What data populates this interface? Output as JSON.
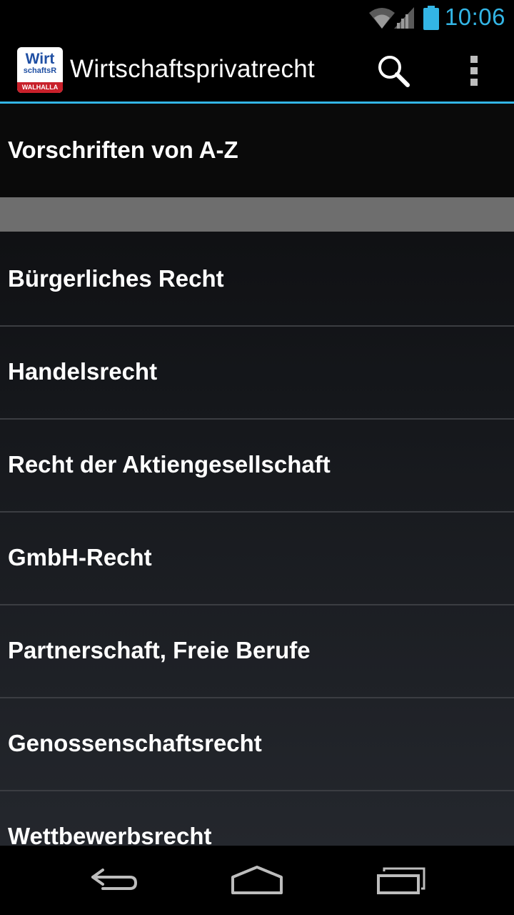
{
  "status_bar": {
    "time": "10:06",
    "icons": [
      "wifi-icon",
      "signal-icon",
      "battery-icon"
    ]
  },
  "action_bar": {
    "logo": {
      "line1": "Wirt",
      "line2": "schaftsR",
      "band": "WALHALLA"
    },
    "title": "Wirtschaftsprivatrecht",
    "icons": [
      "search-icon",
      "overflow-menu-icon"
    ]
  },
  "list": {
    "top_item": "Vorschriften von A-Z",
    "items": [
      "Bürgerliches Recht",
      "Handelsrecht",
      "Recht der Aktiengesellschaft",
      "GmbH-Recht",
      "Partnerschaft, Freie Berufe",
      "Genossenschaftsrecht",
      "Wettbewerbsrecht"
    ]
  },
  "nav_bar": {
    "icons": [
      "back-icon",
      "home-icon",
      "recent-apps-icon"
    ]
  },
  "colors": {
    "accent": "#33b5e5",
    "section_divider": "#6e6e6e",
    "logo_blue": "#1f4fa3",
    "logo_red": "#c8202a"
  }
}
